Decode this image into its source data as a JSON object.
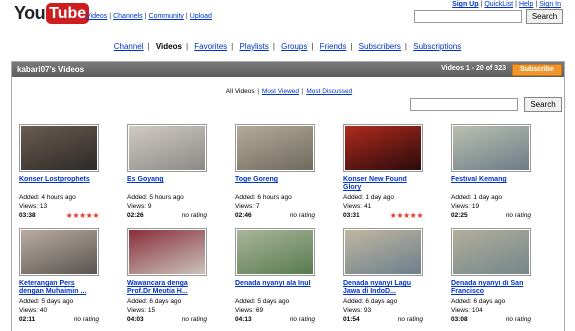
{
  "logo": {
    "you": "You",
    "tube": "Tube"
  },
  "top_links": [
    "Videos",
    "Channels",
    "Community",
    "Upload"
  ],
  "account_links": {
    "signup": "Sign Up",
    "quicklist": "QuickList",
    "help": "Help",
    "signin": "Sign In"
  },
  "header_search": {
    "button": "Search"
  },
  "channel_nav": {
    "items": [
      {
        "label": "Channel",
        "active": false
      },
      {
        "label": "Videos",
        "active": true
      },
      {
        "label": "Favorites",
        "active": false
      },
      {
        "label": "Playlists",
        "active": false
      },
      {
        "label": "Groups",
        "active": false
      },
      {
        "label": "Friends",
        "active": false
      },
      {
        "label": "Subscribers",
        "active": false
      },
      {
        "label": "Subscriptions",
        "active": false
      }
    ]
  },
  "videos_box": {
    "title": "kabari07's Videos",
    "count": "Videos 1 - 20 of 323",
    "subscribe": "Subscribe",
    "filters": {
      "all": "All Videos",
      "most_viewed": "Most Viewed",
      "most_discussed": "Most Discussed"
    },
    "search_button": "Search"
  },
  "videos": [
    {
      "title": "Konser Lostprophets",
      "added": "Added: 4 hours ago",
      "views": "Views: 13",
      "duration": "03:38",
      "rating": "★★★★★",
      "thumb": [
        "#2d2a28",
        "#6a5c50"
      ]
    },
    {
      "title": "Es Goyang",
      "added": "Added: 5 hours ago",
      "views": "Views: 9",
      "duration": "02:26",
      "rating": "no rating",
      "thumb": [
        "#8c8a86",
        "#cfcac2"
      ]
    },
    {
      "title": "Toge Goreng",
      "added": "Added: 6 hours ago",
      "views": "Views: 7",
      "duration": "02:46",
      "rating": "no rating",
      "thumb": [
        "#6e6a5e",
        "#b5aa98"
      ]
    },
    {
      "title": "Konser New Found Glory",
      "added": "Added: 1 day ago",
      "views": "Views: 41",
      "duration": "03:31",
      "rating": "★★★★★",
      "thumb": [
        "#2a0b0b",
        "#b02a1e"
      ]
    },
    {
      "title": "Festival Kemang",
      "added": "Added: 1 day ago",
      "views": "Views: 19",
      "duration": "02:25",
      "rating": "no rating",
      "thumb": [
        "#6d7b86",
        "#b9c0b0"
      ]
    },
    {
      "title": "Keterangan Pers dengan Muhaimin ...",
      "added": "Added: 5 days ago",
      "views": "Views: 40",
      "duration": "02:11",
      "rating": "no rating",
      "thumb": [
        "#5a5452",
        "#b8aca0"
      ]
    },
    {
      "title": "Wawancara denga Prof.Dr Meutia H...",
      "added": "Added: 6 days ago",
      "views": "Views: 15",
      "duration": "04:03",
      "rating": "no rating",
      "thumb": [
        "#c9c2bb",
        "#8a2f3a"
      ]
    },
    {
      "title": "Denada nyanyi ala Inul",
      "added": "Added: 5 days ago",
      "views": "Views: 69",
      "duration": "04:13",
      "rating": "no rating",
      "thumb": [
        "#587c4e",
        "#a8b59a"
      ]
    },
    {
      "title": "Denada nyanyi Lagu Jawa di IndoD...",
      "added": "Added: 6 days ago",
      "views": "Views: 93",
      "duration": "01:54",
      "rating": "no rating",
      "thumb": [
        "#6c7f8c",
        "#c0b6a0"
      ]
    },
    {
      "title": "Denada nyanyi di San Francisco",
      "added": "Added: 6 days ago",
      "views": "Views: 104",
      "duration": "03:08",
      "rating": "no rating",
      "thumb": [
        "#74868a",
        "#b2ae9c"
      ]
    }
  ]
}
